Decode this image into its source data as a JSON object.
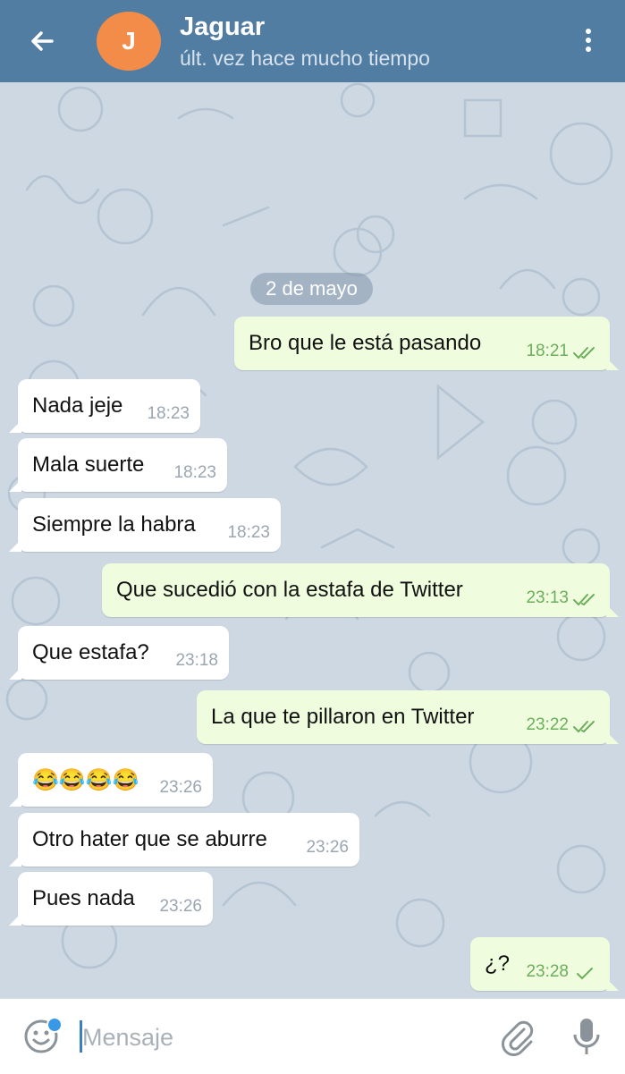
{
  "header": {
    "avatar_letter": "J",
    "title": "Jaguar",
    "subtitle": "últ. vez hace mucho tiempo",
    "avatar_color": "#f28c48",
    "bar_color": "#527da3"
  },
  "chat": {
    "date_label": "2 de mayo",
    "messages": [
      {
        "side": "out",
        "text": "Bro que le está pasando",
        "time": "18:21",
        "status": "read"
      },
      {
        "side": "in",
        "text": "Nada jeje",
        "time": "18:23"
      },
      {
        "side": "in",
        "text": "Mala suerte",
        "time": "18:23"
      },
      {
        "side": "in",
        "text": "Siempre la habra",
        "time": "18:23"
      },
      {
        "side": "out",
        "text": "Que sucedió con la estafa de Twitter",
        "time": "23:13",
        "status": "read"
      },
      {
        "side": "in",
        "text": "Que estafa?",
        "time": "23:18"
      },
      {
        "side": "out",
        "text": "La que te pillaron en Twitter",
        "time": "23:22",
        "status": "read"
      },
      {
        "side": "in",
        "text": "😂😂😂😂",
        "time": "23:26"
      },
      {
        "side": "in",
        "text": "Otro hater que se aburre",
        "time": "23:26"
      },
      {
        "side": "in",
        "text": "Pues nada",
        "time": "23:26"
      },
      {
        "side": "out",
        "text": "¿?",
        "time": "23:28",
        "status": "sent"
      }
    ]
  },
  "input": {
    "placeholder": "Mensaje"
  },
  "icons": {
    "back": "arrow-left-icon",
    "menu": "more-vertical-icon",
    "emoji": "smiley-icon",
    "attach": "paperclip-icon",
    "voice": "microphone-icon"
  }
}
